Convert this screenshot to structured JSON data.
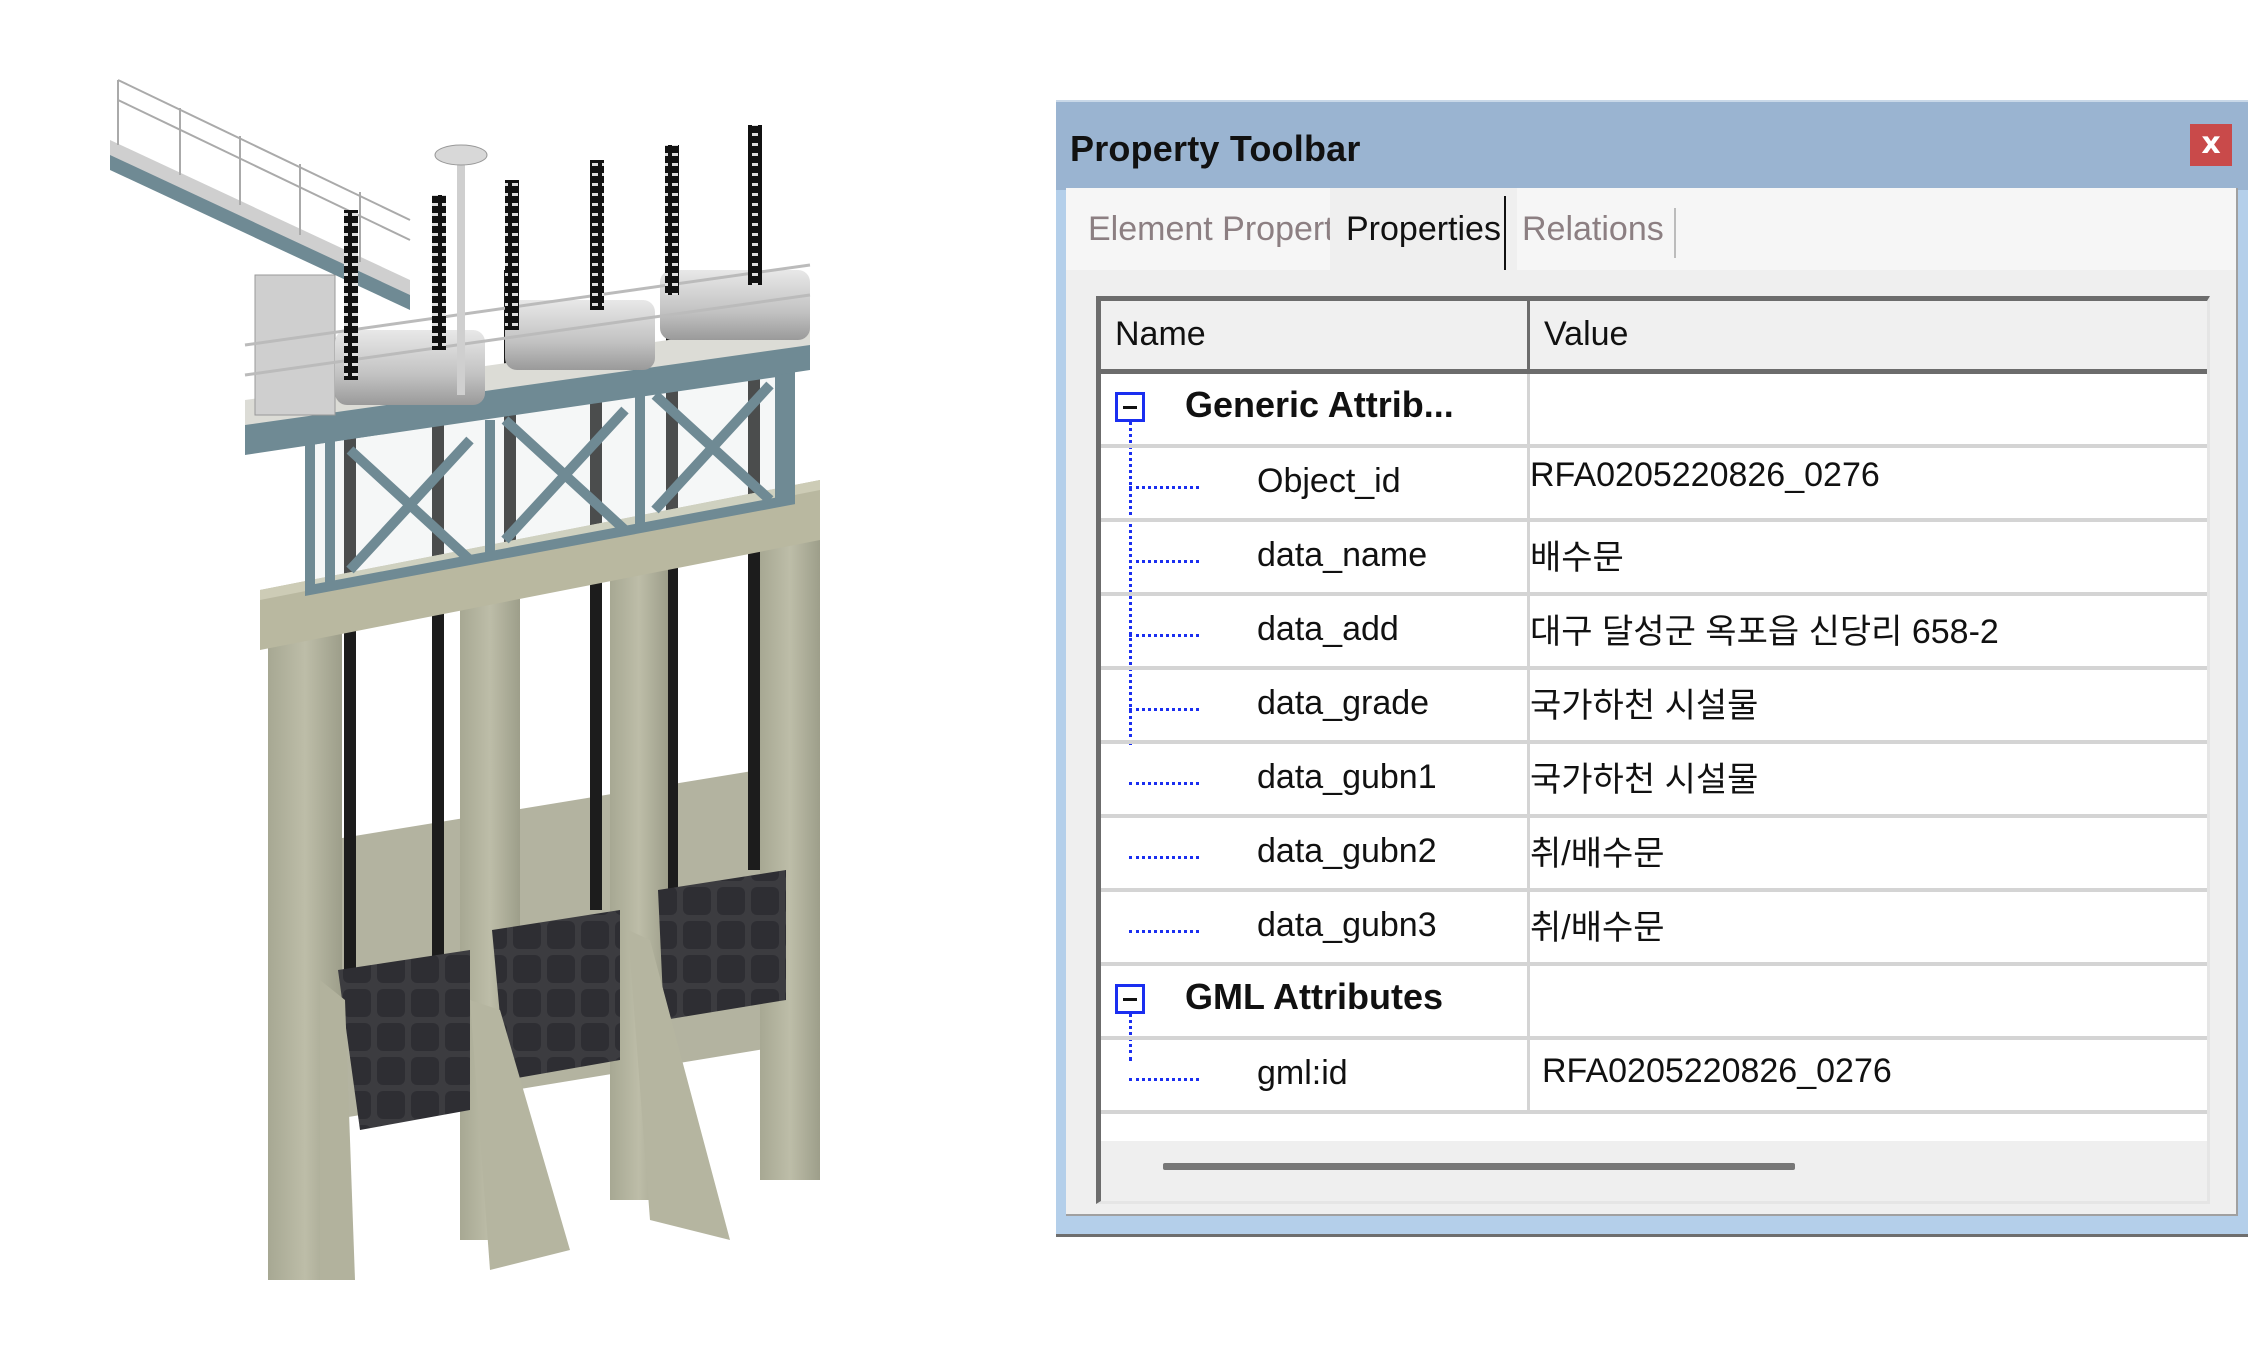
{
  "panel": {
    "title": "Property Toolbar",
    "close_label": "x",
    "close_color": "#c94a4a",
    "titlebar_color": "#9ab4d1"
  },
  "tabs": [
    {
      "label": "Element Properties",
      "active": false
    },
    {
      "label": "Properties",
      "active": true
    },
    {
      "label": "Relations",
      "active": false
    }
  ],
  "grid": {
    "columns": [
      "Name",
      "Value"
    ],
    "groups": [
      {
        "label": "Generic Attrib...",
        "expanded": true,
        "rows": [
          {
            "name": "Object_id",
            "value": "RFA0205220826_0276"
          },
          {
            "name": "data_name",
            "value": "배수문"
          },
          {
            "name": "data_add",
            "value": "대구 달성군 옥포읍 신당리 658-2"
          },
          {
            "name": "data_grade",
            "value": "국가하천 시설물"
          },
          {
            "name": "data_gubn1",
            "value": "국가하천 시설물"
          },
          {
            "name": "data_gubn2",
            "value": "취/배수문"
          },
          {
            "name": "data_gubn3",
            "value": "취/배수문"
          }
        ]
      },
      {
        "label": "GML Attributes",
        "expanded": true,
        "rows": [
          {
            "name": "gml:id",
            "value": "RFA0205220826_0276"
          }
        ]
      }
    ]
  },
  "model": {
    "description": "3D model of sluice gate (배수문) with walkway, hoist platform and three gates",
    "gate_count": 3
  }
}
